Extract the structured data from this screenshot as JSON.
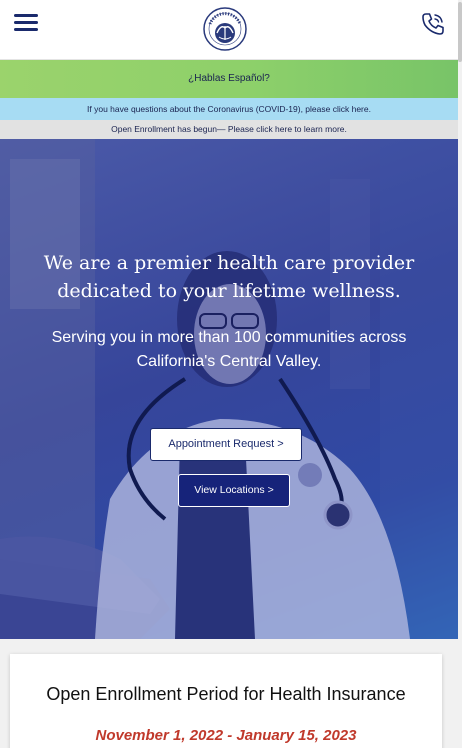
{
  "header": {
    "menu_icon": "hamburger-menu-icon",
    "logo_icon": "clinic-logo-icon",
    "phone_icon": "phone-icon"
  },
  "banners": {
    "spanish": "¿Hablas Español?",
    "covid": "If you have questions about the Coronavirus (COVID-19), please click here.",
    "enrollment": "Open Enrollment has begun— Please click here to learn more."
  },
  "hero": {
    "title_line1": "We are a premier health care provider",
    "title_line2": "dedicated to your lifetime wellness.",
    "subtitle_line1": "Serving you in more than 100 communities across",
    "subtitle_line2": "California's Central Valley.",
    "appointment_button": "Appointment Request >",
    "locations_button": "View Locations >"
  },
  "card": {
    "title": "Open Enrollment Period for Health Insurance",
    "dates": "November 1, 2022 - January 15, 2023"
  },
  "colors": {
    "brand_navy": "#1a2a6c",
    "banner_green": "#8dd06a",
    "banner_blue": "#a7dcf3",
    "banner_gray": "#e2e2e2",
    "accent_red": "#c0392b"
  }
}
